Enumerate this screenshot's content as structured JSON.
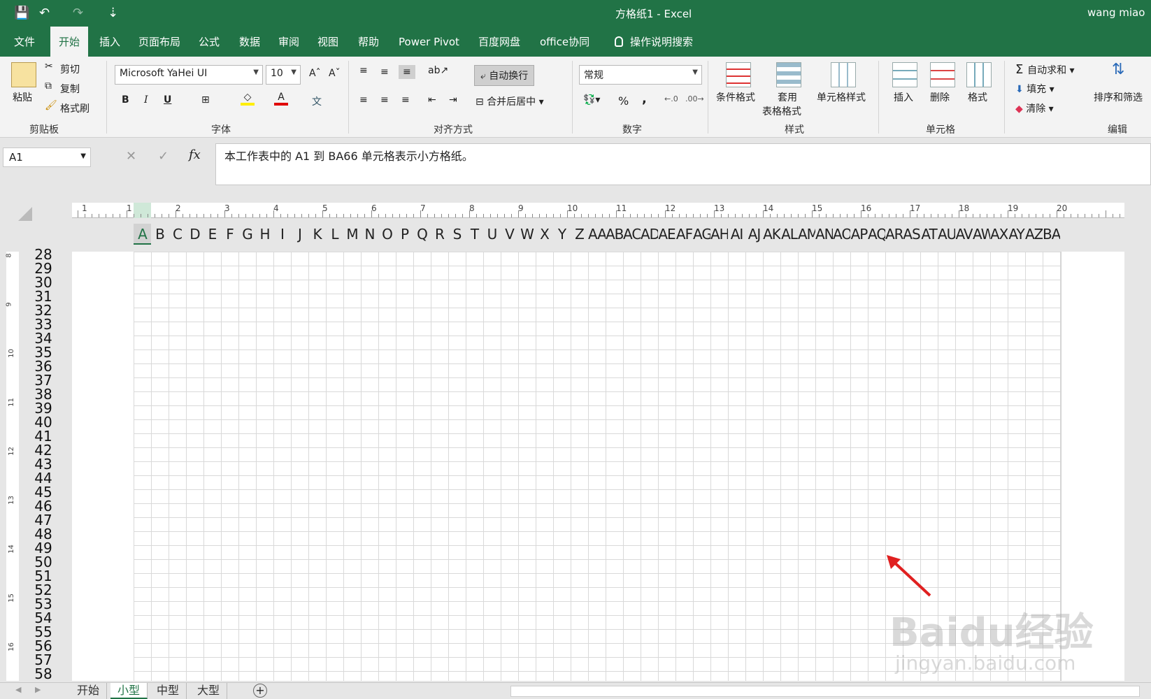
{
  "title_bar": {
    "doc_title": "方格纸1  -  Excel",
    "user": "wang miao",
    "quick_access": [
      {
        "icon": "save-icon",
        "glyph": "💾"
      },
      {
        "icon": "undo-icon",
        "glyph": "↶"
      },
      {
        "icon": "redo-icon",
        "glyph": "↷"
      },
      {
        "icon": "customize-icon",
        "glyph": "⇣"
      }
    ]
  },
  "tabs": [
    {
      "label": "文件"
    },
    {
      "label": "开始",
      "active": true
    },
    {
      "label": "插入"
    },
    {
      "label": "页面布局"
    },
    {
      "label": "公式"
    },
    {
      "label": "数据"
    },
    {
      "label": "审阅"
    },
    {
      "label": "视图"
    },
    {
      "label": "帮助"
    },
    {
      "label": "Power Pivot"
    },
    {
      "label": "百度网盘"
    },
    {
      "label": "office协同"
    }
  ],
  "tell_me": {
    "icon": "lightbulb-icon",
    "label": "操作说明搜索"
  },
  "ribbon": {
    "clipboard": {
      "paste": "粘贴",
      "cut": "剪切",
      "copy": "复制",
      "format_painter": "格式刷",
      "group": "剪贴板"
    },
    "font": {
      "name": "Microsoft YaHei UI",
      "size": "10",
      "bold": "B",
      "italic": "I",
      "underline": "U",
      "group": "字体",
      "grow": "Aˆ",
      "shrink": "Aˇ",
      "phonetic": "文"
    },
    "alignment": {
      "wrap": "自动换行",
      "merge": "合并后居中",
      "group": "对齐方式"
    },
    "number": {
      "format": "常规",
      "percent": "%",
      "comma": ",",
      "group": "数字"
    },
    "styles": {
      "cond": "条件格式",
      "table1": "套用",
      "table2": "表格格式",
      "cell": "单元格样式",
      "group": "样式"
    },
    "cells": {
      "insert": "插入",
      "delete": "删除",
      "format": "格式",
      "group": "单元格"
    },
    "editing": {
      "autosum": "自动求和",
      "fill": "填充",
      "clear": "清除",
      "sort": "排序和筛选",
      "group": "编辑"
    }
  },
  "formula_bar": {
    "name_box": "A1",
    "cancel": "✕",
    "enter": "✓",
    "fx": "fx",
    "content": "本工作表中的 A1 到 BA66 单元格表示小方格纸。"
  },
  "ruler_h": [
    "1",
    "1",
    "2",
    "3",
    "4",
    "5",
    "6",
    "7",
    "8",
    "9",
    "10",
    "11",
    "12",
    "13",
    "14",
    "15",
    "16",
    "17",
    "18",
    "19",
    "20"
  ],
  "columns": [
    "A",
    "B",
    "C",
    "D",
    "E",
    "F",
    "G",
    "H",
    "I",
    "J",
    "K",
    "L",
    "M",
    "N",
    "O",
    "P",
    "Q",
    "R",
    "S",
    "T",
    "U",
    "V",
    "W",
    "X",
    "Y",
    "Z",
    "AA",
    "AB",
    "AC",
    "AD",
    "AE",
    "AF",
    "AG",
    "AH",
    "AI",
    "AJ",
    "AK",
    "AL",
    "AM",
    "AN",
    "AO",
    "AP",
    "AQ",
    "AR",
    "AS",
    "AT",
    "AU",
    "AV",
    "AW",
    "AX",
    "AY",
    "AZ",
    "BA"
  ],
  "rows": [
    "28",
    "29",
    "30",
    "31",
    "32",
    "33",
    "34",
    "35",
    "36",
    "37",
    "38",
    "39",
    "40",
    "41",
    "42",
    "43",
    "44",
    "45",
    "46",
    "47",
    "48",
    "49",
    "50",
    "51",
    "52",
    "53",
    "54",
    "55",
    "56",
    "57",
    "58"
  ],
  "ruler_v": [
    "8",
    "9",
    "10",
    "11",
    "12",
    "13",
    "14",
    "15",
    "16"
  ],
  "sheet_tabs": [
    {
      "label": "开始"
    },
    {
      "label": "小型",
      "active": true
    },
    {
      "label": "中型"
    },
    {
      "label": "大型"
    }
  ],
  "watermark": {
    "brand": "Baidu经验",
    "url": "jingyan.baidu.com"
  }
}
